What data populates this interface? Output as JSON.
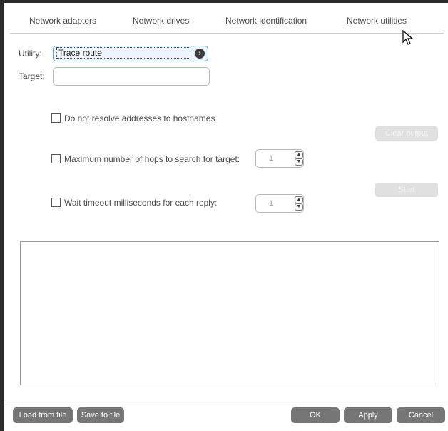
{
  "tabs": [
    {
      "label": "Network adapters"
    },
    {
      "label": "Network drives"
    },
    {
      "label": "Network identification"
    },
    {
      "label": "Network utilities"
    }
  ],
  "utility": {
    "label": "Utility:",
    "value": "Trace route",
    "arrow": "›"
  },
  "target": {
    "label": "Target:",
    "value": ""
  },
  "options": {
    "resolve": "Do not resolve addresses to hostnames",
    "max_hops": "Maximum number of hops to search for target:",
    "max_hops_value": "1",
    "timeout": "Wait timeout milliseconds for each reply:",
    "timeout_value": "1"
  },
  "buttons": {
    "clear_output": "Clear output",
    "start": "Start",
    "load": "Load from file",
    "save": "Save to file",
    "ok": "OK",
    "apply": "Apply",
    "cancel": "Cancel"
  },
  "spin_up": "▲",
  "spin_down": "▼"
}
